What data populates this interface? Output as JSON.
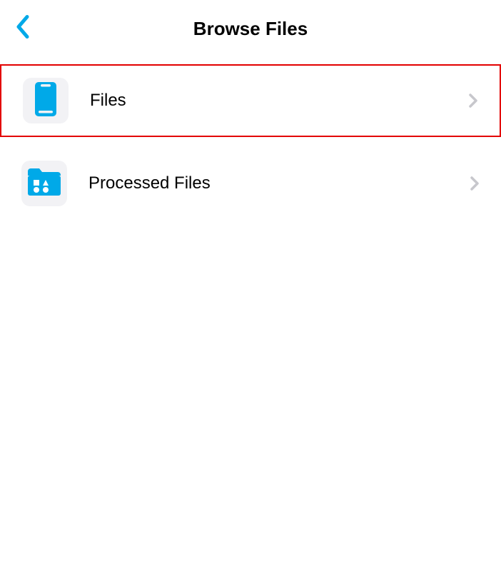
{
  "header": {
    "title": "Browse Files"
  },
  "list": {
    "items": [
      {
        "label": "Files",
        "icon": "phone-icon",
        "highlighted": true
      },
      {
        "label": "Processed Files",
        "icon": "folder-icon",
        "highlighted": false
      }
    ]
  },
  "colors": {
    "accent": "#00a9e8",
    "highlight_border": "#e30000",
    "icon_bg": "#f2f2f5",
    "chevron": "#c7c7cc"
  }
}
